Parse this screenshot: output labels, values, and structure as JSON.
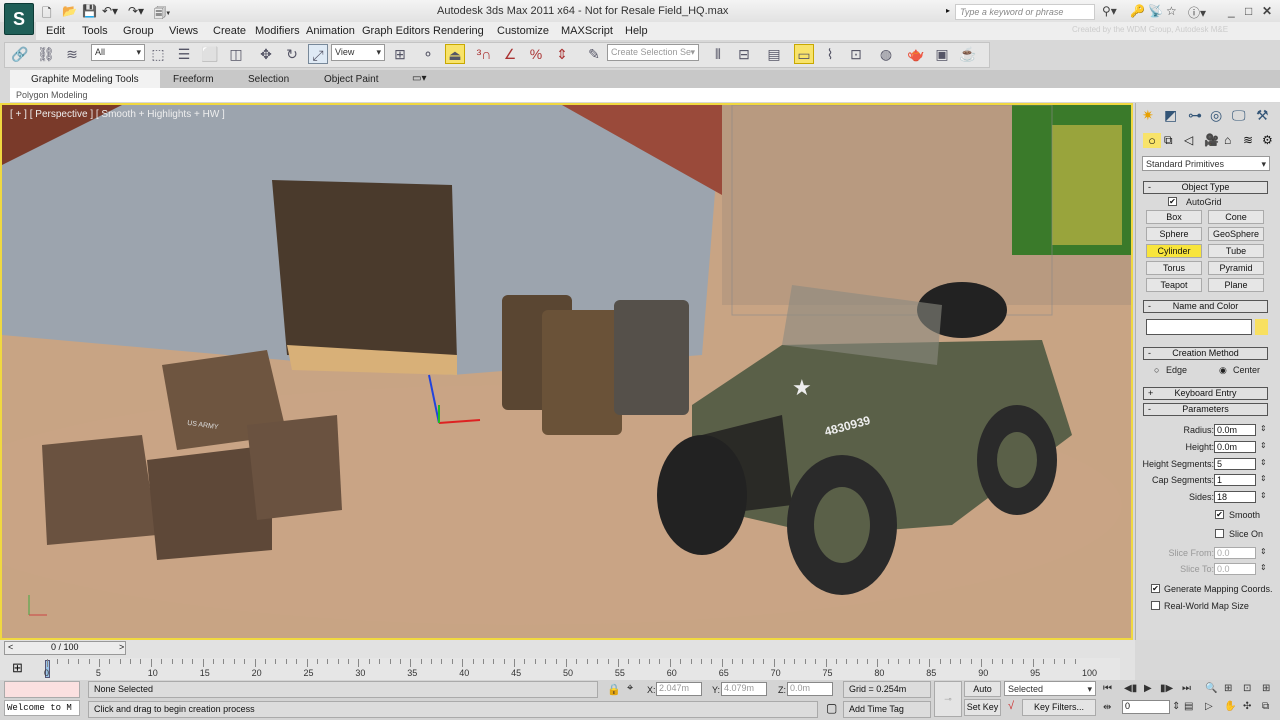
{
  "window": {
    "title": "Autodesk 3ds Max  2011 x64  - Not for Resale   Field_HQ.max",
    "search_placeholder": "Type a keyword or phrase",
    "credit": "Created by the WDM Group, Autodesk M&E"
  },
  "menu": [
    "Edit",
    "Tools",
    "Group",
    "Views",
    "Create",
    "Modifiers",
    "Animation",
    "Graph Editors",
    "Rendering",
    "Customize",
    "MAXScript",
    "Help"
  ],
  "toolbar": {
    "selection_filter": "All",
    "reference_coord": "View",
    "named_selection_placeholder": "Create Selection Se"
  },
  "ribbon": {
    "tabs": [
      "Graphite Modeling Tools",
      "Freeform",
      "Selection",
      "Object Paint"
    ],
    "active_tab": "Graphite Modeling Tools",
    "panel": "Polygon Modeling"
  },
  "viewport": {
    "label": "[ + ] [ Perspective ] [ Smooth + Highlights + HW ]",
    "jeep_number": "4830939",
    "crate_text": "US ARMY"
  },
  "command_panel": {
    "category": "Standard Primitives",
    "object_type": {
      "title": "Object Type",
      "autogrid": "AutoGrid",
      "autogrid_checked": true,
      "buttons": [
        "Box",
        "Cone",
        "Sphere",
        "GeoSphere",
        "Cylinder",
        "Tube",
        "Torus",
        "Pyramid",
        "Teapot",
        "Plane"
      ],
      "active": "Cylinder"
    },
    "name_and_color": {
      "title": "Name and Color",
      "name": "",
      "color": "#f8e060"
    },
    "creation_method": {
      "title": "Creation Method",
      "options": [
        "Edge",
        "Center"
      ],
      "selected": "Center"
    },
    "keyboard_entry": {
      "title": "Keyboard Entry"
    },
    "parameters": {
      "title": "Parameters",
      "radius": {
        "label": "Radius:",
        "value": "0.0m"
      },
      "height": {
        "label": "Height:",
        "value": "0.0m"
      },
      "height_segments": {
        "label": "Height Segments:",
        "value": "5"
      },
      "cap_segments": {
        "label": "Cap Segments:",
        "value": "1"
      },
      "sides": {
        "label": "Sides:",
        "value": "18"
      },
      "smooth": {
        "label": "Smooth",
        "checked": true
      },
      "slice_on": {
        "label": "Slice On",
        "checked": false
      },
      "slice_from": {
        "label": "Slice From:",
        "value": "0.0"
      },
      "slice_to": {
        "label": "Slice To:",
        "value": "0.0"
      },
      "gen_mapping": {
        "label": "Generate Mapping Coords.",
        "checked": true
      },
      "real_world": {
        "label": "Real-World Map Size",
        "checked": false
      }
    }
  },
  "timeline": {
    "slider": "0 / 100",
    "ticks": [
      "0",
      "5",
      "10",
      "15",
      "20",
      "25",
      "30",
      "35",
      "40",
      "45",
      "50",
      "55",
      "60",
      "65",
      "70",
      "75",
      "80",
      "85",
      "90",
      "95",
      "100"
    ]
  },
  "status": {
    "selection": "None Selected",
    "prompt": "Click and drag to begin creation process",
    "listener": "Welcome to M",
    "x_label": "X:",
    "x": "2.047m",
    "y_label": "Y:",
    "y": "4.079m",
    "z_label": "Z:",
    "z": "0.0m",
    "grid": "Grid = 0.254m",
    "add_time_tag": "Add Time Tag",
    "auto_key": "Auto Key",
    "set_key": "Set Key",
    "key_mode": "Selected",
    "key_filters": "Key Filters...",
    "frame": "0"
  }
}
